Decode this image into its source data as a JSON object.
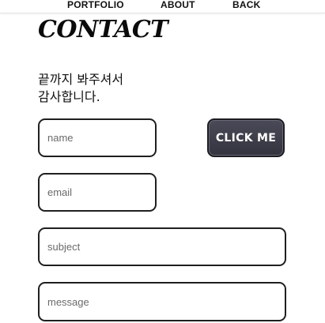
{
  "nav": {
    "portfolio": "PORTFOLIO",
    "about": "ABOUT",
    "back": "BACK"
  },
  "title": "CONTACT",
  "thanks": {
    "line1": "끝까지 봐주셔서",
    "line2": "감사합니다."
  },
  "form": {
    "name_placeholder": "name",
    "email_placeholder": "email",
    "subject_placeholder": "subject",
    "message_placeholder": "message",
    "submit_label": "CLICK ME"
  }
}
